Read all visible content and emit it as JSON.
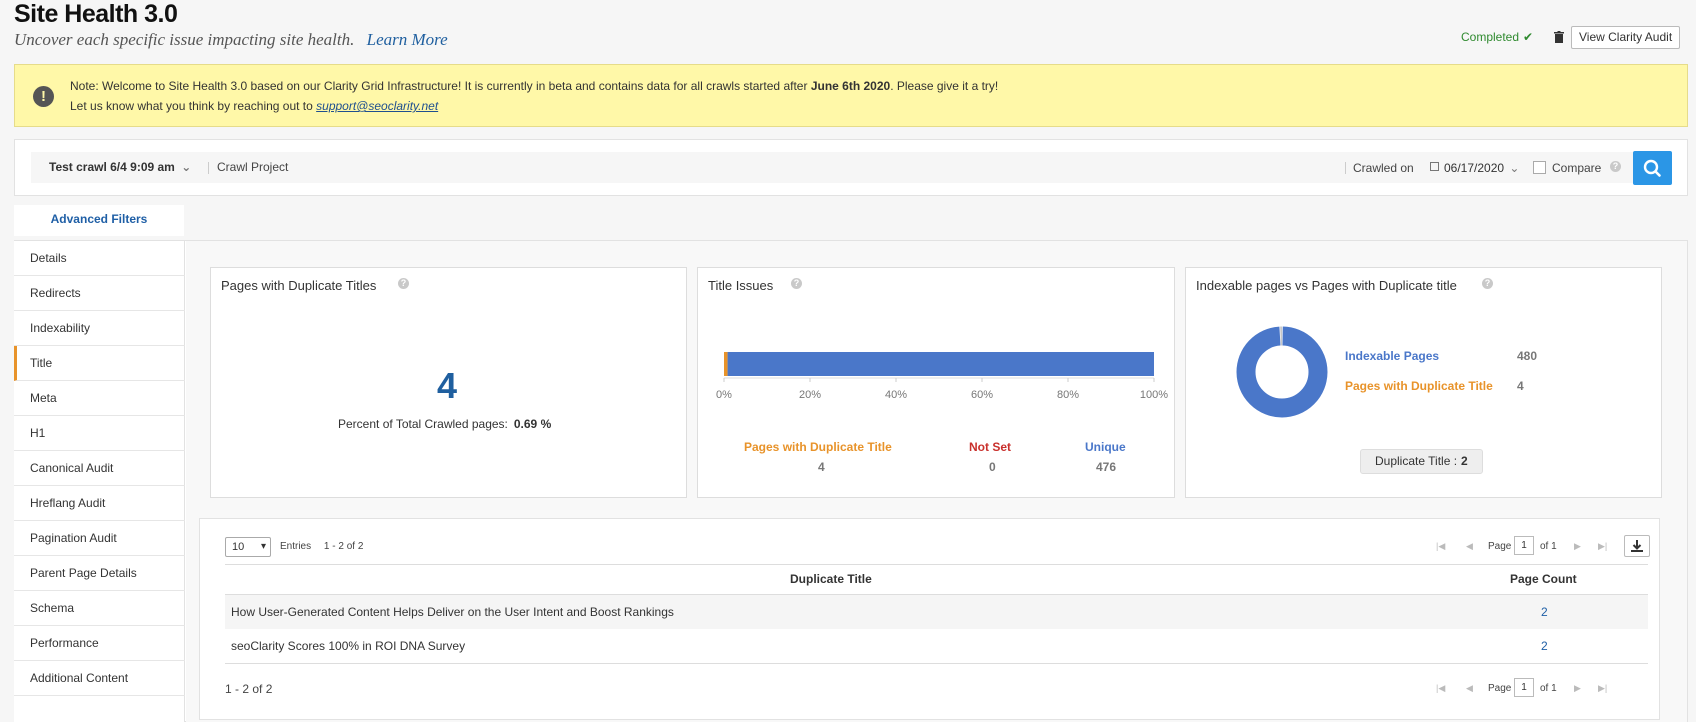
{
  "header": {
    "title": "Site Health 3.0",
    "subtitle": "Uncover each specific issue impacting site health.",
    "learn_more": "Learn More",
    "status": "Completed",
    "view_audit_label": "View Clarity Audit"
  },
  "banner": {
    "line1_prefix": "Note: Welcome to Site Health 3.0 based on our Clarity Grid Infrastructure! It is currently in beta and contains data for all crawls started after",
    "line1_date": "June 6th 2020",
    "line1_suffix": ". Please give it a try!",
    "line2_prefix": "Let us know what you think by reaching out to",
    "email": "support@seoclarity.net"
  },
  "crawl_bar": {
    "crawl_name": "Test crawl 6/4 9:09 am",
    "project": "Crawl Project",
    "crawled_on_label": "Crawled on",
    "date": "06/17/2020",
    "compare_label": "Compare"
  },
  "filters_tab": "Advanced Filters",
  "sidebar": {
    "items": [
      {
        "label": "Details"
      },
      {
        "label": "Redirects"
      },
      {
        "label": "Indexability"
      },
      {
        "label": "Title"
      },
      {
        "label": "Meta"
      },
      {
        "label": "H1"
      },
      {
        "label": "Canonical Audit"
      },
      {
        "label": "Hreflang Audit"
      },
      {
        "label": "Pagination Audit"
      },
      {
        "label": "Parent Page Details"
      },
      {
        "label": "Schema"
      },
      {
        "label": "Performance"
      },
      {
        "label": "Additional Content"
      }
    ],
    "active": "Title"
  },
  "cards": {
    "duplicate_titles": {
      "title": "Pages with Duplicate Titles",
      "count": "4",
      "percent_label": "Percent of Total Crawled pages:",
      "percent_value": "0.69 %"
    },
    "title_issues": {
      "title": "Title Issues",
      "ticks": [
        "0%",
        "20%",
        "40%",
        "60%",
        "80%",
        "100%"
      ],
      "legend": [
        {
          "label": "Pages with Duplicate Title",
          "value": "4",
          "color": "#e8932a"
        },
        {
          "label": "Not Set",
          "value": "0",
          "color": "#c9302c"
        },
        {
          "label": "Unique",
          "value": "476",
          "color": "#4a77c9"
        }
      ]
    },
    "indexable": {
      "title": "Indexable pages vs Pages with Duplicate title",
      "legend": [
        {
          "label": "Indexable Pages",
          "value": "480",
          "color": "#4a77c9"
        },
        {
          "label": "Pages with Duplicate Title",
          "value": "4",
          "color": "#e8932a"
        }
      ],
      "pill_label": "Duplicate Title :",
      "pill_value": "2"
    }
  },
  "table": {
    "page_size": "10",
    "entries_label": "Entries",
    "range": "1 - 2 of 2",
    "page_label": "Page",
    "page": "1",
    "of_label": "of 1",
    "columns": [
      "Duplicate Title",
      "Page Count"
    ],
    "rows": [
      {
        "title": "How User-Generated Content Helps Deliver on the User Intent and Boost Rankings",
        "count": "2"
      },
      {
        "title": "seoClarity Scores 100% in ROI DNA Survey",
        "count": "2"
      }
    ],
    "footer_range": "1 - 2 of 2"
  },
  "chart_data": [
    {
      "type": "bar",
      "title": "Title Issues",
      "orientation": "horizontal-stacked-percent",
      "categories": [
        "Title Issues"
      ],
      "series": [
        {
          "name": "Pages with Duplicate Title",
          "values": [
            4
          ]
        },
        {
          "name": "Not Set",
          "values": [
            0
          ]
        },
        {
          "name": "Unique",
          "values": [
            476
          ]
        }
      ],
      "xlim": [
        0,
        100
      ],
      "ticks": [
        "0%",
        "20%",
        "40%",
        "60%",
        "80%",
        "100%"
      ]
    },
    {
      "type": "pie",
      "title": "Indexable pages vs Pages with Duplicate title",
      "donut": true,
      "labels": [
        "Indexable Pages",
        "Pages with Duplicate Title"
      ],
      "values": [
        480,
        4
      ]
    }
  ]
}
